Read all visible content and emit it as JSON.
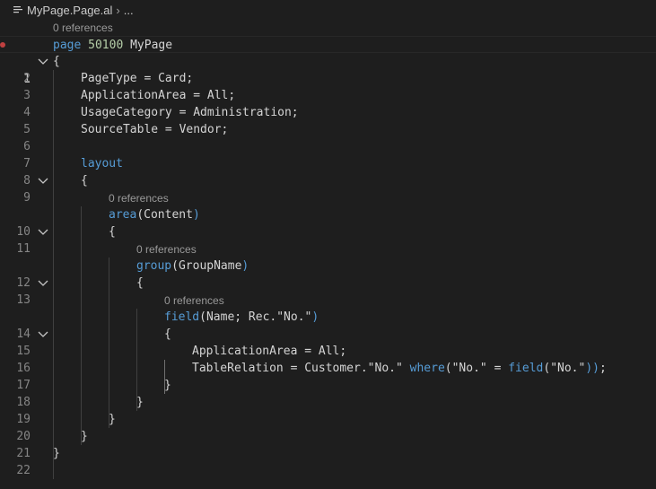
{
  "breadcrumb": {
    "file_icon": "list-file-icon",
    "file_name": "MyPage.Page.al",
    "separator": "›",
    "more": "..."
  },
  "code_lens": {
    "label": "0 references"
  },
  "editor": {
    "current_line": 1,
    "fold_icon": "chevron-down-icon",
    "lines": [
      {
        "n": "1",
        "text": "page 50100 MyPage"
      },
      {
        "n": "2",
        "text": "{"
      },
      {
        "n": "3",
        "text": "PageType = Card;"
      },
      {
        "n": "4",
        "text": "ApplicationArea = All;"
      },
      {
        "n": "5",
        "text": "UsageCategory = Administration;"
      },
      {
        "n": "6",
        "text": "SourceTable = Vendor;"
      },
      {
        "n": "7",
        "text": ""
      },
      {
        "n": "8",
        "text": "layout"
      },
      {
        "n": "9",
        "text": "{"
      },
      {
        "n": "10",
        "text": "area(Content)"
      },
      {
        "n": "11",
        "text": "{"
      },
      {
        "n": "12",
        "text": "group(GroupName)"
      },
      {
        "n": "13",
        "text": "{"
      },
      {
        "n": "14",
        "text": "field(Name; Rec.\"No.\")"
      },
      {
        "n": "15",
        "text": "{"
      },
      {
        "n": "16",
        "text": "ApplicationArea = All;"
      },
      {
        "n": "17",
        "text": "TableRelation = Customer.\"No.\" where(\"No.\" = field(\"No.\"));"
      },
      {
        "n": "18",
        "text": "}"
      },
      {
        "n": "19",
        "text": "}"
      },
      {
        "n": "20",
        "text": "}"
      },
      {
        "n": "21",
        "text": "}"
      },
      {
        "n": "22",
        "text": "}"
      }
    ]
  },
  "colors": {
    "background": "#1e1e1e",
    "keyword": "#569cd6",
    "number": "#b5cea8",
    "text": "#d4d4d4",
    "line_number": "#858585",
    "codelens": "#999999",
    "breakpoint": "#c04040"
  }
}
